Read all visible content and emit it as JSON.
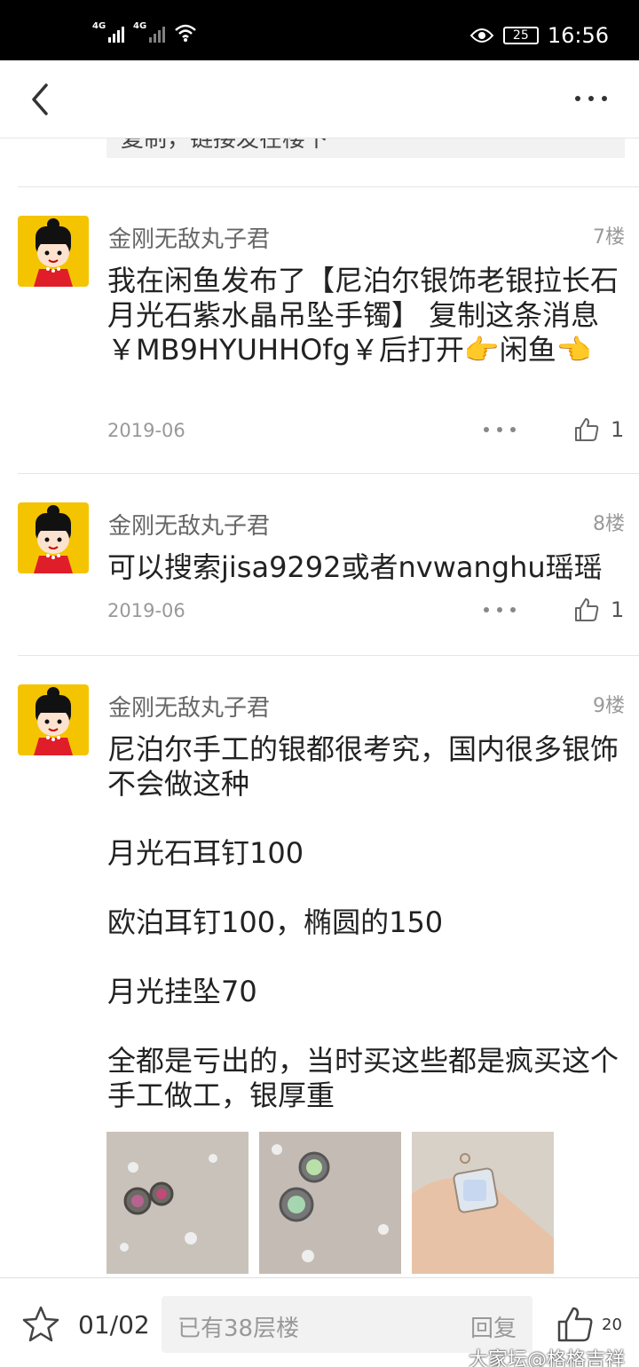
{
  "status_bar": {
    "signal1": "4G",
    "signal2": "4G",
    "battery": "25",
    "time": "16:56"
  },
  "quoted_text": "复制，链接发在楼下",
  "posts": [
    {
      "username": "金刚无敌丸子君",
      "floor": "7楼",
      "content": "我在闲鱼发布了【尼泊尔银饰老银拉长石月光石紫水晶吊坠手镯】 复制这条消息￥MB9HYUHHOfg￥后打开👉闲鱼👈",
      "date": "2019-06",
      "likes": "1"
    },
    {
      "username": "金刚无敌丸子君",
      "floor": "8楼",
      "content": "可以搜索jisa9292或者nvwanghu瑶瑶",
      "date": "2019-06",
      "likes": "1"
    },
    {
      "username": "金刚无敌丸子君",
      "floor": "9楼",
      "content": "尼泊尔手工的银都很考究，国内很多银饰不会做这种\n\n月光石耳钉100\n\n欧泊耳钉100，椭圆的150\n\n月光挂坠70\n\n全都是亏出的，当时买这些都是疯买这个手工做工，银厚重"
    }
  ],
  "bottom_bar": {
    "page_indicator": "01/02",
    "reply_placeholder": "已有38层楼",
    "reply_button": "回复",
    "like_count": "20",
    "watermark": "大家坛@格格吉祥"
  },
  "colors": {
    "status_bar": "#000000",
    "text_gray": "#999999",
    "avatar_bg": "#f5c400"
  }
}
